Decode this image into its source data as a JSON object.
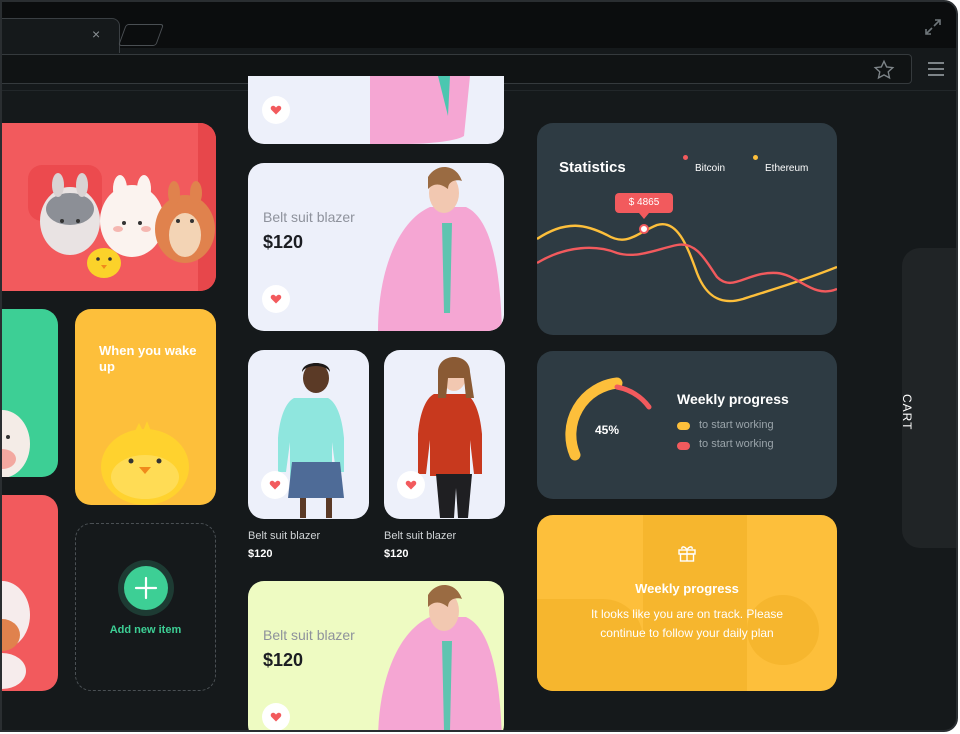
{
  "browser": {
    "close_glyph": "×",
    "icons": [
      "close-icon",
      "expand-icon",
      "star-icon",
      "menu-icon"
    ]
  },
  "left_column": {
    "yellow_card_title": "When you wake up",
    "add_item_label": "Add new item"
  },
  "products": {
    "featured": {
      "name": "Belt suit blazer",
      "price": "$120"
    },
    "small_1": {
      "name": "Belt suit blazer",
      "price": "$120"
    },
    "small_2": {
      "name": "Belt suit blazer",
      "price": "$120"
    },
    "bottom": {
      "name": "Belt suit blazer",
      "price": "$120"
    }
  },
  "statistics": {
    "title": "Statistics",
    "legend": [
      "Bitcoin",
      "Ethereum"
    ],
    "tooltip": "$ 4865",
    "colors": {
      "bitcoin": "#f25a5d",
      "ethereum": "#fdbf3b"
    }
  },
  "weekly": {
    "title": "Weekly progress",
    "percent_label": "45%",
    "progress": 0.45,
    "legend": [
      "to start working",
      "to start working"
    ]
  },
  "promo": {
    "title": "Weekly progress",
    "text": "It looks like you are on track. Please continue to follow your daily plan"
  },
  "cart_label": "CART",
  "colors": {
    "accent_red": "#f25a5d",
    "accent_green": "#3dcf95",
    "accent_yellow": "#fdbf3b",
    "card_dark": "#2e3b43"
  }
}
